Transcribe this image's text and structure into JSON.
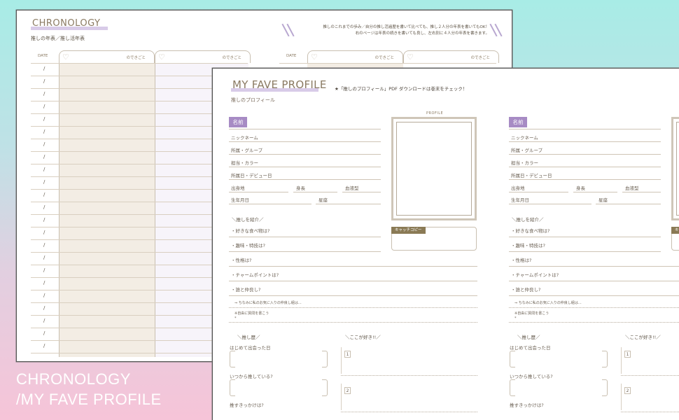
{
  "chronology": {
    "title": "CHRONOLOGY",
    "subtitle": "推しの年表／推し活年表",
    "note_line1": "推しのこれまでの歩み／自分の推し活遍歴を書いて比べても、推し２人分の年表を書いてもOK！",
    "note_line2": "右のページは年表の続きを書いても良し、左右別に４人分の年表を書きます。",
    "date_label": "DATE",
    "event_label": "のできごと",
    "slash_mark": "/"
  },
  "profile": {
    "title": "MY FAVE PROFILE",
    "note": "★「推しのプロフィール」PDF ダウンロードは巻末をチェック！",
    "subtitle": "推しのプロフィール",
    "name_badge": "名前",
    "fields": [
      "ニックネーム",
      "所属・グループ",
      "担当・カラー",
      "所属日・デビュー日"
    ],
    "birthplace": "出身地",
    "height": "身長",
    "blood_type": "血液型",
    "birthday": "生年月日",
    "zodiac": "星座",
    "photo_label": "PROFILE",
    "catchcopy": "キャッチコピー",
    "intro_head": "推しを紹介",
    "intro_questions": [
      "・好きな食べ物は?",
      "・趣味・特技は?",
      "・性格は?",
      "・チャームポイントは?",
      "・誰と仲良し?"
    ],
    "friend_note": "⇒ ちなみに私のお気に入りの仲良し組は…",
    "free_note": "※自由に質問を書こう",
    "history_head": "推し歴",
    "history_questions": [
      "はじめて出会った日",
      "いつから推している?",
      "推すきっかけは?"
    ],
    "like_head": "ここが好き!!",
    "like_nums": [
      "1",
      "2"
    ]
  },
  "caption": {
    "line1": "CHRONOLOGY",
    "line2": "/MY FAVE PROFILE"
  }
}
